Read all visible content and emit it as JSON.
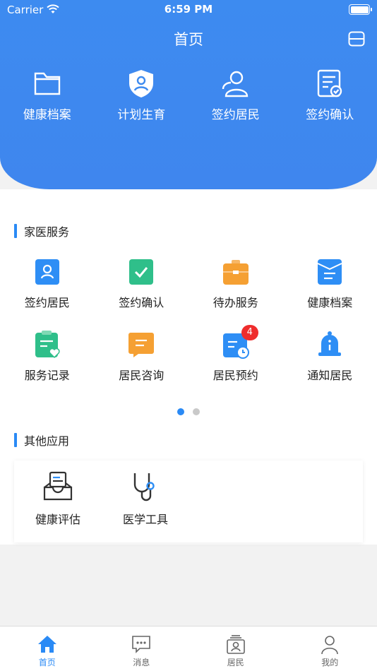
{
  "status_bar": {
    "carrier": "Carrier",
    "time": "6:59 PM"
  },
  "header": {
    "title": "首页"
  },
  "top_nav": [
    {
      "label": "健康档案",
      "icon": "folder-icon"
    },
    {
      "label": "计划生育",
      "icon": "shield-person-icon"
    },
    {
      "label": "签约居民",
      "icon": "user-icon"
    },
    {
      "label": "签约确认",
      "icon": "document-check-icon"
    }
  ],
  "family_doctor": {
    "title": "家医服务",
    "items": [
      {
        "label": "签约居民",
        "icon": "contract-resident-icon",
        "color": "#2e8ef5"
      },
      {
        "label": "签约确认",
        "icon": "check-icon",
        "color": "#2fbf8a"
      },
      {
        "label": "待办服务",
        "icon": "briefcase-icon",
        "color": "#f5a033"
      },
      {
        "label": "健康档案",
        "icon": "file-icon",
        "color": "#2e8ef5"
      },
      {
        "label": "服务记录",
        "icon": "clipboard-heart-icon",
        "color": "#2fbf8a"
      },
      {
        "label": "居民咨询",
        "icon": "chat-icon",
        "color": "#f5a033"
      },
      {
        "label": "居民预约",
        "icon": "calendar-clock-icon",
        "color": "#2e8ef5",
        "badge": "4"
      },
      {
        "label": "通知居民",
        "icon": "bell-icon",
        "color": "#2e8ef5"
      }
    ]
  },
  "other_apps": {
    "title": "其他应用",
    "items": [
      {
        "label": "健康评估",
        "icon": "assessment-icon"
      },
      {
        "label": "医学工具",
        "icon": "stethoscope-icon"
      }
    ]
  },
  "tab_bar": [
    {
      "label": "首页",
      "icon": "home-icon",
      "active": true
    },
    {
      "label": "消息",
      "icon": "message-icon",
      "active": false
    },
    {
      "label": "居民",
      "icon": "resident-icon",
      "active": false
    },
    {
      "label": "我的",
      "icon": "profile-icon",
      "active": false
    }
  ],
  "colors": {
    "accent": "#2a8af5",
    "header": "#3d8bf0",
    "badge": "#ef2d2d"
  }
}
